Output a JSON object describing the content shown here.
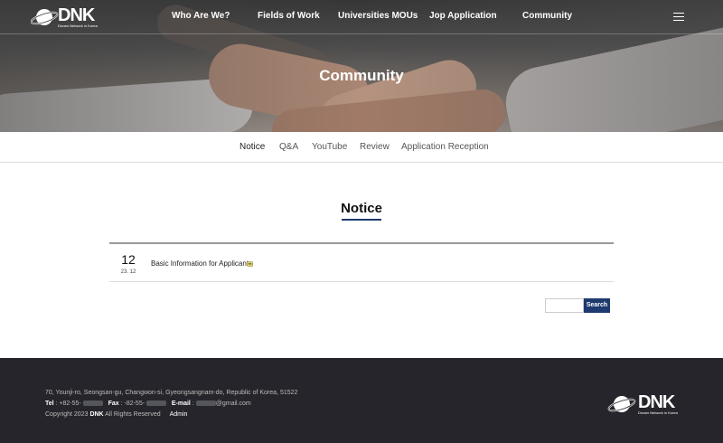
{
  "header": {
    "logo_text": "DNK",
    "logo_sub": "Dream Network in Korea",
    "nav": [
      "Who Are We?",
      "Fields of Work",
      "Universities MOUs",
      "Jop Application",
      "Community"
    ]
  },
  "hero": {
    "title": "Community"
  },
  "subnav": [
    "Notice",
    "Q&A",
    "YouTube",
    "Review",
    "Application Reception"
  ],
  "board": {
    "title": "Notice",
    "posts": [
      {
        "day": "12",
        "date": "23. 12",
        "subject": "Basic Information for Applicant"
      }
    ],
    "search_button": "Search",
    "search_value": ""
  },
  "footer": {
    "address": "70, Younji-ro, Seongsan-gu, Changwon-si, Gyeongsangnam-do, Republic of Korea, 51522",
    "tel_label": "Tel",
    "tel_value": ": +82-55-",
    "fax_label": "Fax",
    "fax_value": ": -82-55-",
    "email_label": "E-mail",
    "email_value": ":",
    "email_suffix": "@gmail.com",
    "copyright_pre": "Copyright 2023",
    "copyright_brand": "DNK",
    "copyright_post": "All Rights Reserved",
    "admin": "Admin",
    "logo_text": "DNK",
    "logo_sub": "Dream Network in Korea"
  },
  "colors": {
    "accent": "#1e3a6e",
    "footer_bg": "#25252b"
  }
}
